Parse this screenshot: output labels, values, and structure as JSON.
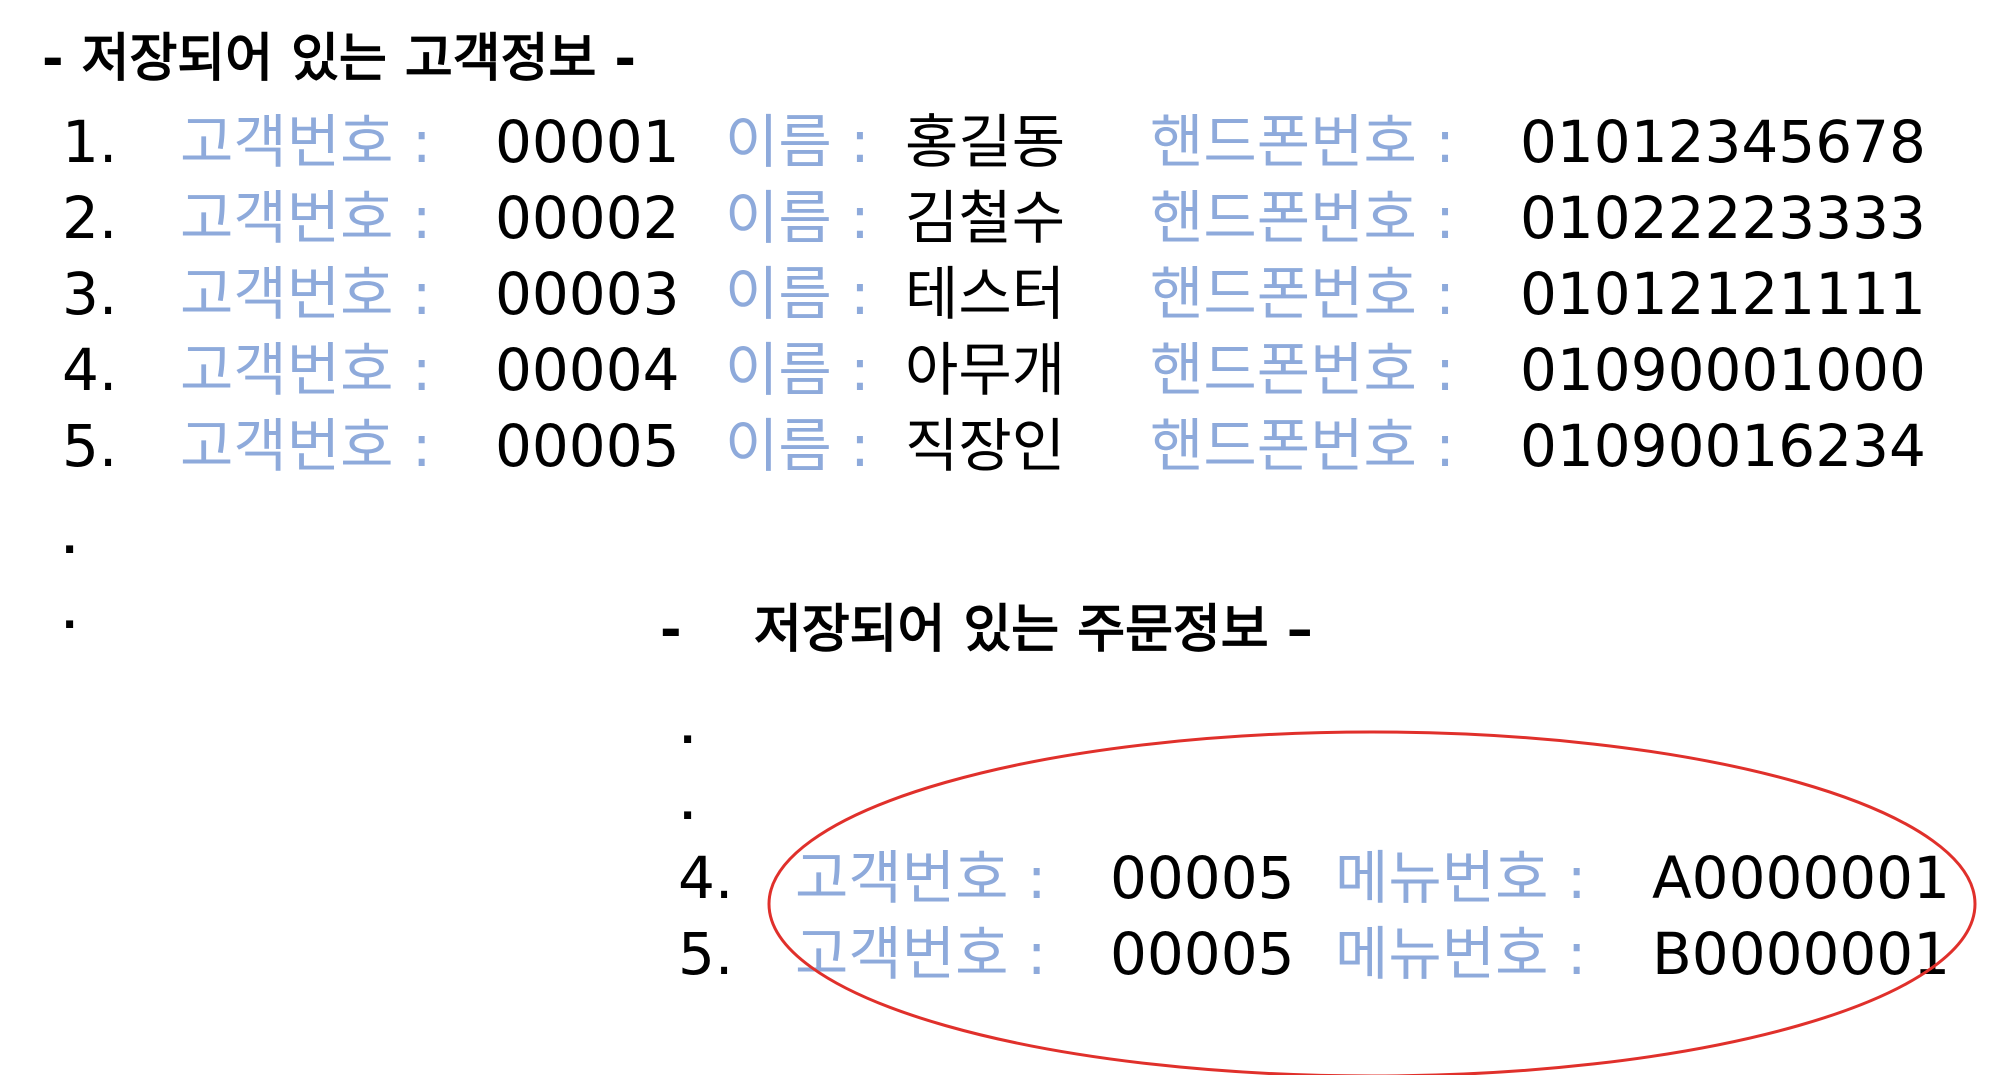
{
  "customers_heading": "- 저장되어 있는 고객정보 -",
  "customers": [
    {
      "index": "1.",
      "id_label": "고객번호 :",
      "id": "00001",
      "name_label": "이름 :",
      "name": "홍길동",
      "phone_label": "핸드폰번호 :",
      "phone": "01012345678"
    },
    {
      "index": "2.",
      "id_label": "고객번호 :",
      "id": "00002",
      "name_label": "이름 :",
      "name": "김철수",
      "phone_label": "핸드폰번호 :",
      "phone": "01022223333"
    },
    {
      "index": "3.",
      "id_label": "고객번호 :",
      "id": "00003",
      "name_label": "이름 :",
      "name": "테스터",
      "phone_label": "핸드폰번호 :",
      "phone": "01012121111"
    },
    {
      "index": "4.",
      "id_label": "고객번호 :",
      "id": "00004",
      "name_label": "이름 :",
      "name": "아무개",
      "phone_label": "핸드폰번호 :",
      "phone": "01090001000"
    },
    {
      "index": "5.",
      "id_label": "고객번호 :",
      "id": "00005",
      "name_label": "이름 :",
      "name": "직장인",
      "phone_label": "핸드폰번호 :",
      "phone": "01090016234"
    }
  ],
  "customers_ellipsis": [
    ".",
    "."
  ],
  "orders_heading": "-    저장되어 있는 주문정보 –",
  "orders_ellipsis": [
    ".",
    "."
  ],
  "orders": [
    {
      "index": "4.",
      "id_label": "고객번호 :",
      "id": "00005",
      "menu_label": "메뉴번호 :",
      "menu": "A0000001"
    },
    {
      "index": "5.",
      "id_label": "고객번호 :",
      "id": "00005",
      "menu_label": "메뉴번호 :",
      "menu": "B0000001"
    }
  ],
  "highlight_color": "#e0302b",
  "label_color": "#8eaadb"
}
